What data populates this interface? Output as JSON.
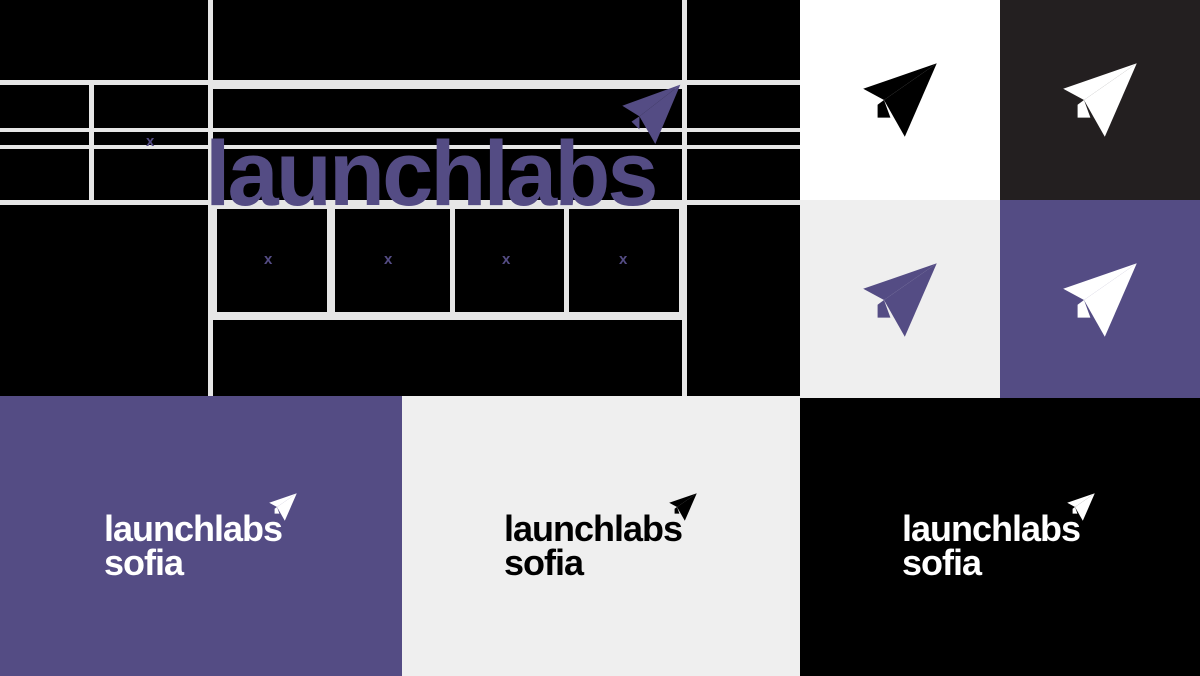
{
  "brand": {
    "wordmark_primary": "launchlabs",
    "wordmark_secondary": "sofia",
    "spacing_unit_label": "x",
    "icon": "paper-plane-icon"
  },
  "colors": {
    "purple": "#544c84",
    "black": "#000000",
    "charcoal": "#231f20",
    "white": "#ffffff",
    "light_gray": "#efefef",
    "grid_line": "#e6e6e6"
  },
  "icon_tiles": [
    {
      "background": "white",
      "icon_color": "black"
    },
    {
      "background": "charcoal",
      "icon_color": "white"
    },
    {
      "background": "light_gray",
      "icon_color": "purple"
    },
    {
      "background": "purple",
      "icon_color": "white"
    }
  ],
  "lockups": [
    {
      "background": "purple",
      "text_color": "white"
    },
    {
      "background": "light_gray",
      "text_color": "black"
    },
    {
      "background": "black",
      "text_color": "white"
    }
  ]
}
